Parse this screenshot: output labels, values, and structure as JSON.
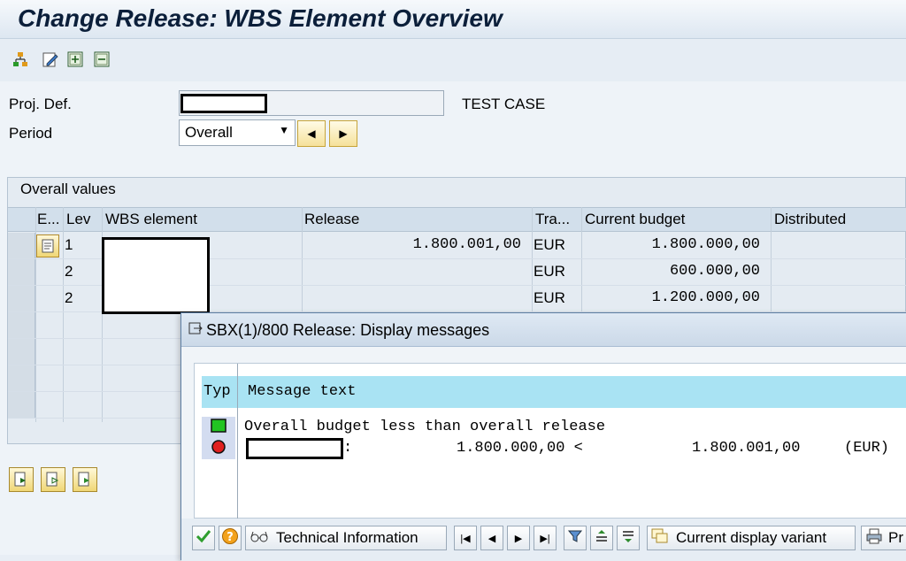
{
  "window": {
    "title": "Change Release: WBS Element Overview"
  },
  "toolbar": {
    "icons": [
      "hierarchy-icon",
      "edit-icon",
      "expand-icon",
      "collapse-icon"
    ]
  },
  "header": {
    "proj_def_label": "Proj. Def.",
    "proj_def_value": "",
    "proj_desc": "TEST CASE",
    "period_label": "Period",
    "period_value": "Overall"
  },
  "overall": {
    "title": "Overall values",
    "columns": [
      "E...",
      "Lev",
      "WBS element",
      "Release",
      "Tra...",
      "Current budget",
      "Distributed"
    ],
    "rows": [
      {
        "lev": "1",
        "release": "1.800.001,00",
        "currency": "EUR",
        "budget": "1.800.000,00"
      },
      {
        "lev": "2",
        "release": "",
        "currency": "EUR",
        "budget": "600.000,00"
      },
      {
        "lev": "2",
        "release": "",
        "currency": "EUR",
        "budget": "1.200.000,00"
      }
    ]
  },
  "dialog": {
    "title": "SBX(1)/800 Release: Display messages",
    "col_type": "Typ",
    "col_text": "Message text",
    "msg_line1": "Overall budget less than overall release",
    "msg_line2_budget": "1.800.000,00 <",
    "msg_line2_release": "1.800.001,00",
    "msg_line2_curr": "(EUR)",
    "buttons": {
      "technical_info": "Technical Information",
      "display_variant": "Current display variant",
      "print_partial": "Pr"
    }
  },
  "colors": {
    "accent": "#0b1f3a",
    "msg_header_bg": "#a9e3f3",
    "status_green": "#22c422",
    "status_red": "#e02020"
  }
}
